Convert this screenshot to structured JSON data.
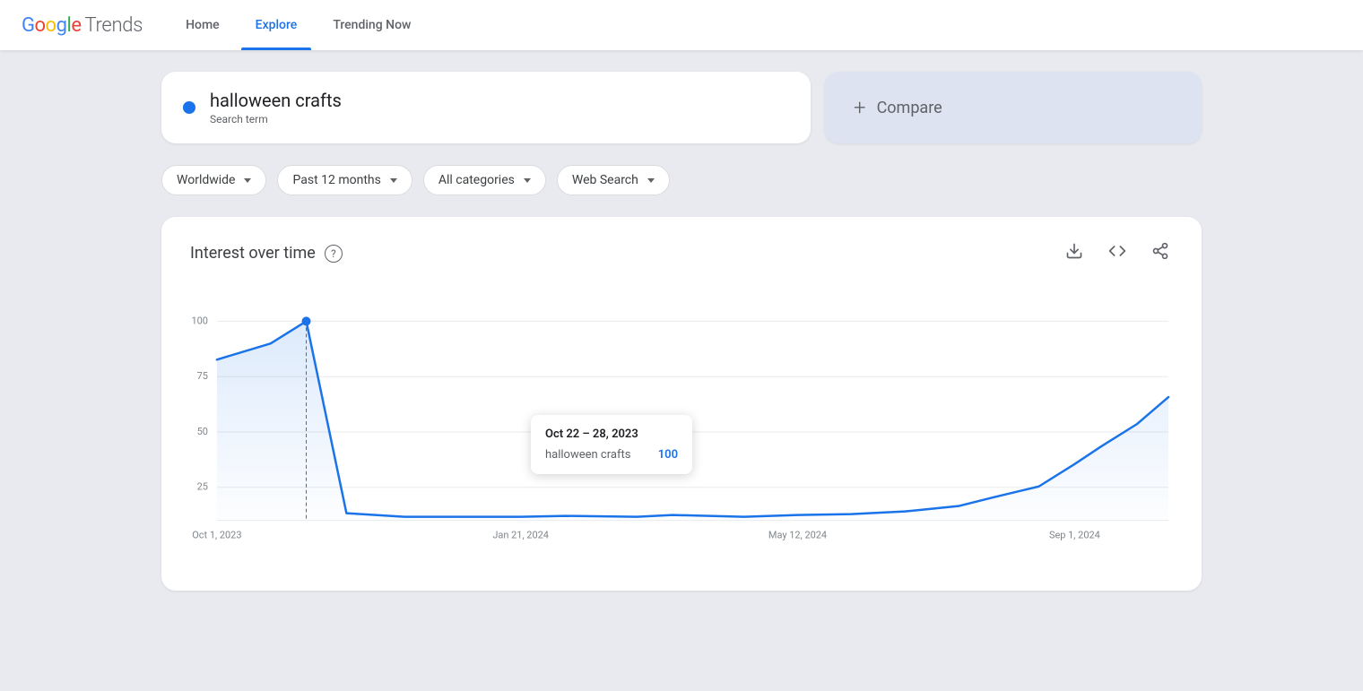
{
  "header": {
    "logo_google": "Google",
    "logo_trends": "Trends",
    "nav": [
      {
        "id": "home",
        "label": "Home",
        "active": false
      },
      {
        "id": "explore",
        "label": "Explore",
        "active": true
      },
      {
        "id": "trending-now",
        "label": "Trending Now",
        "active": false
      }
    ]
  },
  "search": {
    "term": "halloween crafts",
    "term_type": "Search term",
    "compare_label": "Compare",
    "compare_plus": "+"
  },
  "filters": [
    {
      "id": "location",
      "label": "Worldwide"
    },
    {
      "id": "time",
      "label": "Past 12 months"
    },
    {
      "id": "category",
      "label": "All categories"
    },
    {
      "id": "search_type",
      "label": "Web Search"
    }
  ],
  "chart": {
    "title": "Interest over time",
    "help_icon": "?",
    "actions": [
      {
        "id": "download",
        "icon": "↓",
        "label": "download-icon"
      },
      {
        "id": "embed",
        "icon": "<>",
        "label": "embed-icon"
      },
      {
        "id": "share",
        "icon": "⤢",
        "label": "share-icon"
      }
    ],
    "y_labels": [
      "100",
      "75",
      "50",
      "25"
    ],
    "x_labels": [
      "Oct 1, 2023",
      "Jan 21, 2024",
      "May 12, 2024",
      "Sep 1, 2024"
    ],
    "tooltip": {
      "date": "Oct 22 – 28, 2023",
      "term": "halloween crafts",
      "value": "100"
    }
  }
}
